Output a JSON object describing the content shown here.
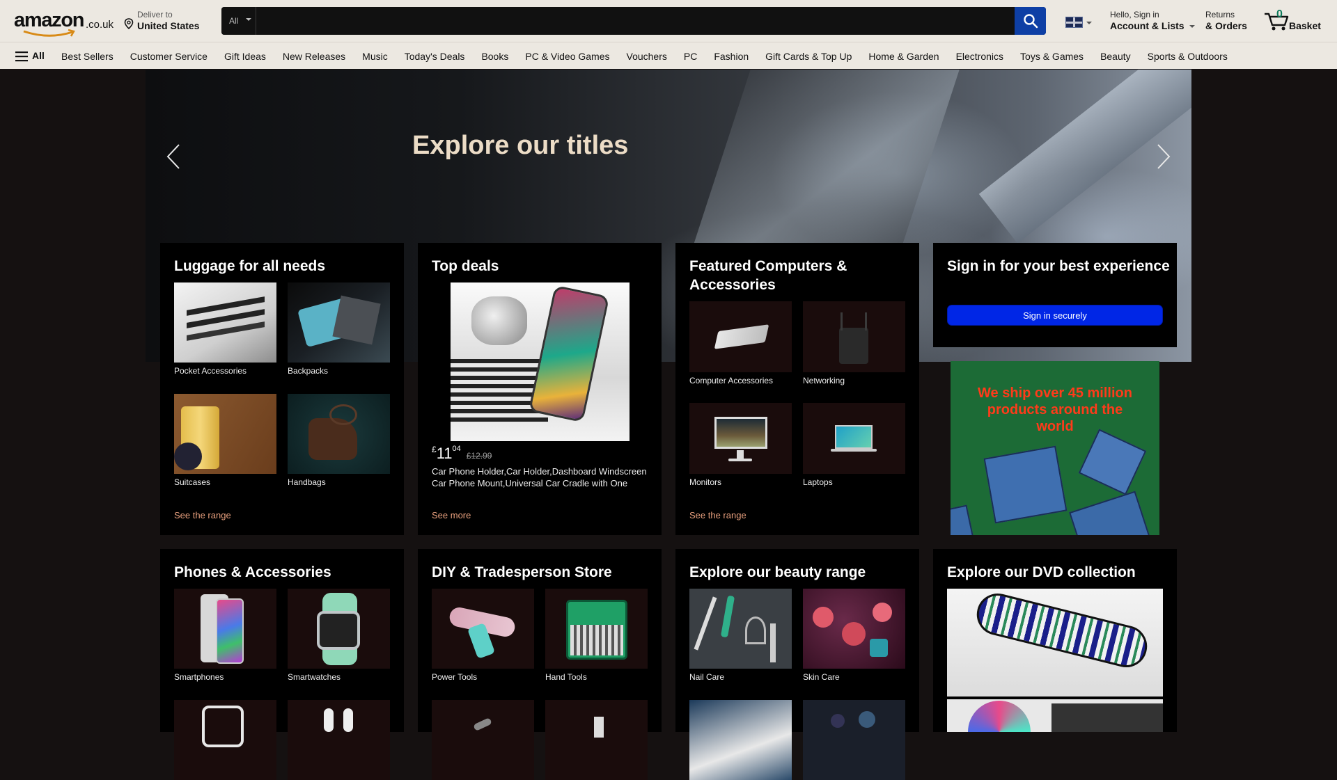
{
  "header": {
    "logo_text": "amazon",
    "logo_suffix": ".co.uk",
    "deliver_line1": "Deliver to",
    "deliver_line2": "United States",
    "search_category": "All",
    "search_placeholder": "",
    "account_line1": "Hello, Sign in",
    "account_line2": "Account & Lists",
    "returns_line1": "Returns",
    "returns_line2": "& Orders",
    "basket_count": "0",
    "basket_label": "Basket"
  },
  "nav": {
    "all_label": "All",
    "links": [
      "Best Sellers",
      "Customer Service",
      "Gift Ideas",
      "New Releases",
      "Music",
      "Today's Deals",
      "Books",
      "PC & Video Games",
      "Vouchers",
      "PC",
      "Fashion",
      "Gift Cards & Top Up",
      "Home & Garden",
      "Electronics",
      "Toys & Games",
      "Beauty",
      "Sports & Outdoors"
    ]
  },
  "hero": {
    "title": "Explore our titles"
  },
  "cards": {
    "luggage": {
      "title": "Luggage for all needs",
      "tiles": [
        "Pocket Accessories",
        "Backpacks",
        "Suitcases",
        "Handbags"
      ],
      "link": "See the range"
    },
    "deals": {
      "title": "Top deals",
      "price_currency": "£",
      "price_whole": "11",
      "price_fraction": "04",
      "price_old": "£12.99",
      "product_title": "Car Phone Holder,Car Holder,Dashboard Windscreen Car Phone Mount,Universal Car Cradle with One Button Release",
      "link": "See more"
    },
    "computers": {
      "title": "Featured Computers & Accessories",
      "tiles": [
        "Computer Accessories",
        "Networking",
        "Monitors",
        "Laptops"
      ],
      "link": "See the range"
    },
    "signin": {
      "title": "Sign in for your best experience",
      "button": "Sign in securely"
    },
    "promo": {
      "text": "We ship over 45 million products around the world"
    },
    "phones": {
      "title": "Phones & Accessories",
      "tiles": [
        "Smartphones",
        "Smartwatches"
      ]
    },
    "diy": {
      "title": "DIY & Tradesperson Store",
      "tiles": [
        "Power Tools",
        "Hand Tools"
      ]
    },
    "beauty": {
      "title": "Explore our beauty range",
      "tiles": [
        "Nail Care",
        "Skin Care"
      ]
    },
    "dvd": {
      "title": "Explore our DVD collection"
    }
  }
}
